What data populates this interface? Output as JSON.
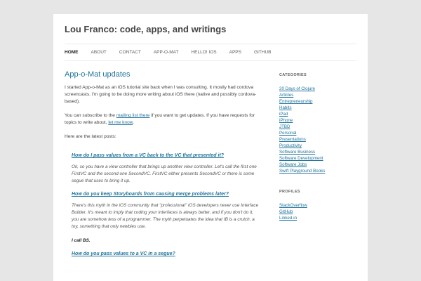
{
  "site": {
    "title": "Lou Franco: code, apps, and writings"
  },
  "nav": {
    "items": [
      "HOME",
      "ABOUT",
      "CONTACT",
      "APP-O-MAT",
      "HELLO! IOS",
      "APPS",
      "GITHUB"
    ]
  },
  "post": {
    "title": "App-o-Mat updates",
    "intro": "I started App-o-Mat as an iOS tutorial site back when I was consulting. It mostly had cordova screencasts. I'm going to be doing more writing about iOS there (native and possibly cordova-based).",
    "subscribe": {
      "before": "You can subscribe to the ",
      "link1": "mailing list there",
      "middle": " if you want to get updates. If you have requests for topics to write about, ",
      "link2": "let me know",
      "after": "."
    },
    "latest_label": "Here are the latest posts:",
    "entries": [
      {
        "title": "How do I pass values from a VC back to the VC that presented it?",
        "text": "Ok, so you have a view controller that brings up another view controller. Let's call the first one FirstVC and the second one SecondVC. FirstVC either presents SecondVC or there is some segue that uses to bring it up."
      },
      {
        "title": "How do you keep Storyboards from causing merge problems later?",
        "text": "There's this myth in the iOS community that \"professional\" iOS developers never use Interface Builder. It's meant to imply that coding your interfaces is always better, and if you don't do it, you are somehow less of a programmer. The myth perpetuates the idea that IB is a crutch, a toy, something that only newbies use."
      }
    ],
    "call_bs": "I call BS.",
    "third_entry_title": "How do you pass values to a VC in a segue?"
  },
  "sidebar": {
    "categories_title": "CATEGORIES",
    "categories": [
      "20 Days of Clojure",
      "Articles",
      "Entrepreneurship",
      "Habits",
      "iPad",
      "iPhone",
      "JTBD",
      "Personal",
      "Presentations",
      "Productivity",
      "Software Business",
      "Software Development",
      "Software Jobs",
      "Swift Playground Books"
    ],
    "profiles_title": "PROFILES",
    "profiles": [
      "StackOverflow",
      "GitHub",
      "Linked-in"
    ]
  }
}
